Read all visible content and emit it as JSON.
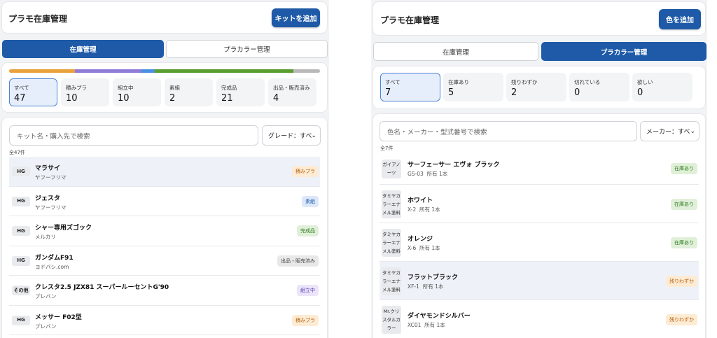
{
  "screenA": {
    "app_title": "プラモ在庫管理",
    "add_button": "キットを追加",
    "tabs": [
      {
        "label": "在庫管理",
        "active": true
      },
      {
        "label": "プラカラー管理",
        "active": false
      }
    ],
    "progress_segments": [
      {
        "status": "積みプラ",
        "count": 10,
        "color": "#e9a23b"
      },
      {
        "status": "組立中",
        "count": 10,
        "color": "#8e7cd6"
      },
      {
        "status": "素組",
        "count": 2,
        "color": "#4a90e2"
      },
      {
        "status": "完成品",
        "count": 21,
        "color": "#5a9e2f"
      },
      {
        "status": "出品・販売済み",
        "count": 4,
        "color": "#b9b9b9"
      }
    ],
    "stats": [
      {
        "label": "すべて",
        "value": "47"
      },
      {
        "label": "積みプラ",
        "value": "10"
      },
      {
        "label": "組立中",
        "value": "10"
      },
      {
        "label": "素組",
        "value": "2"
      },
      {
        "label": "完成品",
        "value": "21"
      },
      {
        "label": "出品・販売済み",
        "value": "4"
      }
    ],
    "search_placeholder": "キット名・購入先で検索",
    "filter_select": "グレード：すべ",
    "count_label": "全47件",
    "items": [
      {
        "grade": "HG",
        "name": "マラサイ",
        "shop": "ヤフーフリマ",
        "status": "積みプラ",
        "status_color": "orange"
      },
      {
        "grade": "HG",
        "name": "ジェスタ",
        "shop": "ヤフーフリマ",
        "status": "素組",
        "status_color": "blue"
      },
      {
        "grade": "HG",
        "name": "シャー専用ズゴック",
        "shop": "メルカリ",
        "status": "完成品",
        "status_color": "green"
      },
      {
        "grade": "HG",
        "name": "ガンダムF91",
        "shop": "ヨドバシ.com",
        "status": "出品・販売済み",
        "status_color": "gray"
      },
      {
        "grade": "その他",
        "name": "クレスタ2.5 JZX81 スーパールーセントG'90",
        "shop": "プレバン",
        "status": "組立中",
        "status_color": "purple"
      },
      {
        "grade": "HG",
        "name": "メッサー F02型",
        "shop": "プレバン",
        "status": "積みプラ",
        "status_color": "orange"
      }
    ]
  },
  "screenB": {
    "app_title": "プラモ在庫管理",
    "add_button": "色を追加",
    "tabs": [
      {
        "label": "在庫管理",
        "active": false
      },
      {
        "label": "プラカラー管理",
        "active": true
      }
    ],
    "stats": [
      {
        "label": "すべて",
        "value": "7"
      },
      {
        "label": "在庫あり",
        "value": "5"
      },
      {
        "label": "残りわずか",
        "value": "2"
      },
      {
        "label": "切れている",
        "value": "0"
      },
      {
        "label": "欲しい",
        "value": "0"
      }
    ],
    "search_placeholder": "色名・メーカー・型式番号で検索",
    "filter_select": "メーカー：すべ",
    "count_label": "全7件",
    "items": [
      {
        "maker": "ガイアノーツ",
        "name": "サーフェーサー エヴォ ブラック",
        "code": "GS-03",
        "owned": "所有 1本",
        "status": "在庫あり",
        "status_color": "green"
      },
      {
        "maker": "タミヤカラーエナメル塗料",
        "name": "ホワイト",
        "code": "X-2",
        "owned": "所有 1本",
        "status": "在庫あり",
        "status_color": "green"
      },
      {
        "maker": "タミヤカラーエナメル塗料",
        "name": "オレンジ",
        "code": "X-6",
        "owned": "所有 1本",
        "status": "在庫あり",
        "status_color": "green"
      },
      {
        "maker": "タミヤカラーエナメル塗料",
        "name": "フラットブラック",
        "code": "XF-1",
        "owned": "所有 1本",
        "status": "残りわずか",
        "status_color": "orange"
      },
      {
        "maker": "Mr.クリスタルカラー",
        "name": "ダイヤモンドシルバー",
        "code": "XC01",
        "owned": "所有 1本",
        "status": "残りわずか",
        "status_color": "orange"
      }
    ]
  },
  "badge_colors": {
    "orange": {
      "bg": "#fdebd3",
      "fg": "#b5600f"
    },
    "blue": {
      "bg": "#dce8fa",
      "fg": "#1e5aa8"
    },
    "green": {
      "bg": "#e0f0d8",
      "fg": "#2f7a20"
    },
    "gray": {
      "bg": "#e8e8e8",
      "fg": "#444444"
    },
    "purple": {
      "bg": "#ebe5fa",
      "fg": "#5a3fb5"
    }
  }
}
